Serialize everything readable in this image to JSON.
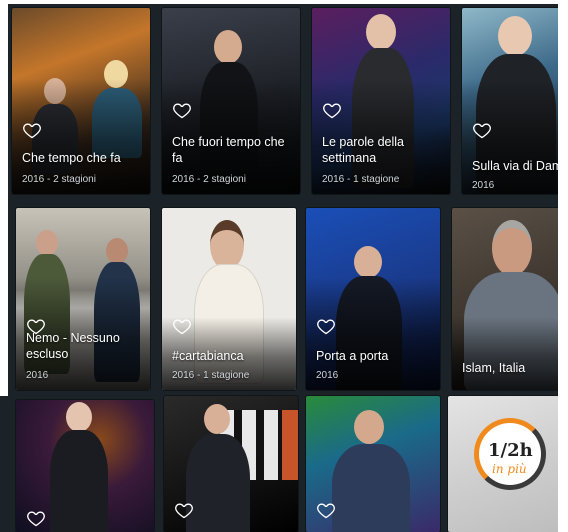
{
  "programs": [
    {
      "title": "Che tempo che fa",
      "meta": "2016 - 2 stagioni"
    },
    {
      "title": "Che fuori tempo che fa",
      "meta": "2016 - 2 stagioni"
    },
    {
      "title": "Le parole della settimana",
      "meta": "2016 - 1 stagione"
    },
    {
      "title": "Sulla via di Damasco",
      "meta": "2016"
    },
    {
      "title": "Nemo - Nessuno escluso",
      "meta": "2016"
    },
    {
      "title": "#cartabianca",
      "meta": "2016 - 1 stagione"
    },
    {
      "title": "Porta a porta",
      "meta": "2016"
    },
    {
      "title": "Islam, Italia",
      "meta": ""
    },
    {
      "title": "",
      "meta": ""
    },
    {
      "title": "",
      "meta": ""
    },
    {
      "title": "",
      "meta": ""
    },
    {
      "title": "",
      "meta": ""
    }
  ],
  "logo": {
    "line1": "1/2h",
    "line2": "in più"
  },
  "colors": {
    "accent": "#f08a1c",
    "heart": "#ffffff",
    "background": "#1b2329"
  }
}
